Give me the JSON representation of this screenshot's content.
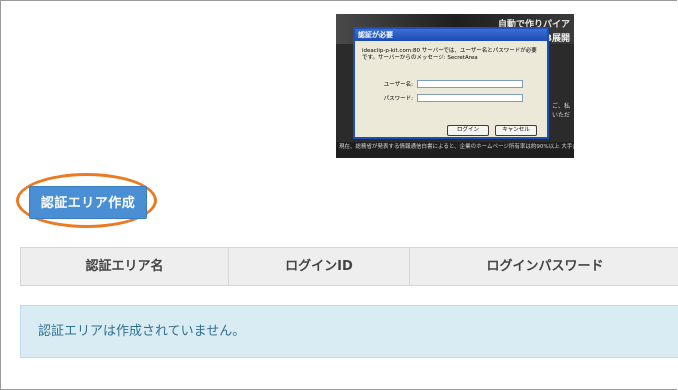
{
  "dialog": {
    "title": "認証が必要",
    "message": "ideaclip-p-kit.com:80 サーバーでは、ユーザー名とパスワードが必要です。サーバーからのメッセージ: SecretArea",
    "username_label": "ユーザー名:",
    "password_label": "パスワード:",
    "login_label": "ログイン",
    "cancel_label": "キャンセル"
  },
  "thumbnail": {
    "headline": "自動で作りパイア",
    "headline2": "B展開",
    "side_text": "ご、私 いただ",
    "bottom_text": "現在、総務省が発表する情報通信白書によると、企業のホームページ所有率は約90%以上 大手企業のみならず、中小企業においてもホームページを活用したIT化が進んでいます。"
  },
  "actions": {
    "create_label": "認証エリア作成"
  },
  "table": {
    "columns": [
      "認証エリア名",
      "ログインID",
      "ログインパスワード"
    ]
  },
  "notice": {
    "empty_message": "認証エリアは作成されていません。"
  },
  "colors": {
    "button": "#4a8fd4",
    "highlight": "#ec7a23",
    "notice_bg": "#d9ecf3",
    "notice_text": "#31708f"
  }
}
